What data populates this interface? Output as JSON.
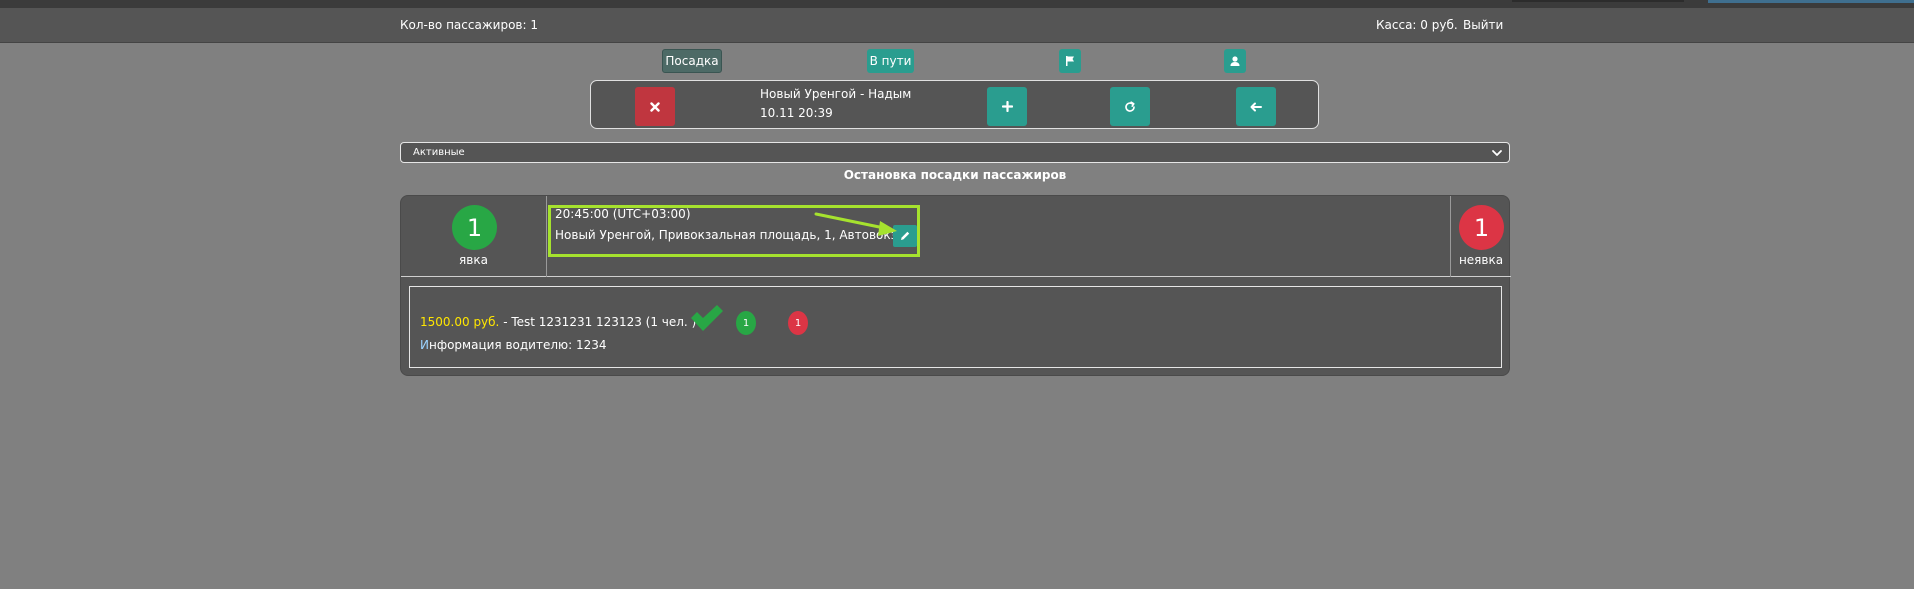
{
  "header": {
    "passenger_count": "Кол-во пассажиров: 1",
    "cash": "Касса: 0 руб.",
    "logout": "Выйти"
  },
  "tabs": [
    {
      "label": "Посадка",
      "active": true
    },
    {
      "label": "В пути",
      "active": false
    },
    {
      "icon": "flag-icon"
    },
    {
      "icon": "user-icon"
    }
  ],
  "route": {
    "title": "Новый Уренгой - Надым",
    "datetime": "10.11 20:39",
    "buttons": [
      "close-icon",
      "plus-icon",
      "refresh-icon",
      "arrow-left-icon"
    ]
  },
  "filter": {
    "selected": "Активные"
  },
  "section_title": "Остановка посадки пассажиров",
  "stop": {
    "present_count": "1",
    "present_label": "явка",
    "absent_count": "1",
    "absent_label": "неявка",
    "time": "20:45:00 (UTC+03:00)",
    "address": "Новый Уренгой, Привокзальная площадь, 1, Автовокзал"
  },
  "passenger": {
    "price": "1500.00 руб.",
    "details": " - Test 1231231 123123 (1 чел. )",
    "present_badge": "1",
    "absent_badge": "1",
    "info_first": "И",
    "info_rest": "нформация водителю: 1234"
  },
  "colors": {
    "background": "#808080",
    "panel": "#555555",
    "teal": "#2a9d8f",
    "red": "#dc3545",
    "green": "#28a745",
    "highlight": "#a6e22e",
    "price": "#ffe600"
  }
}
